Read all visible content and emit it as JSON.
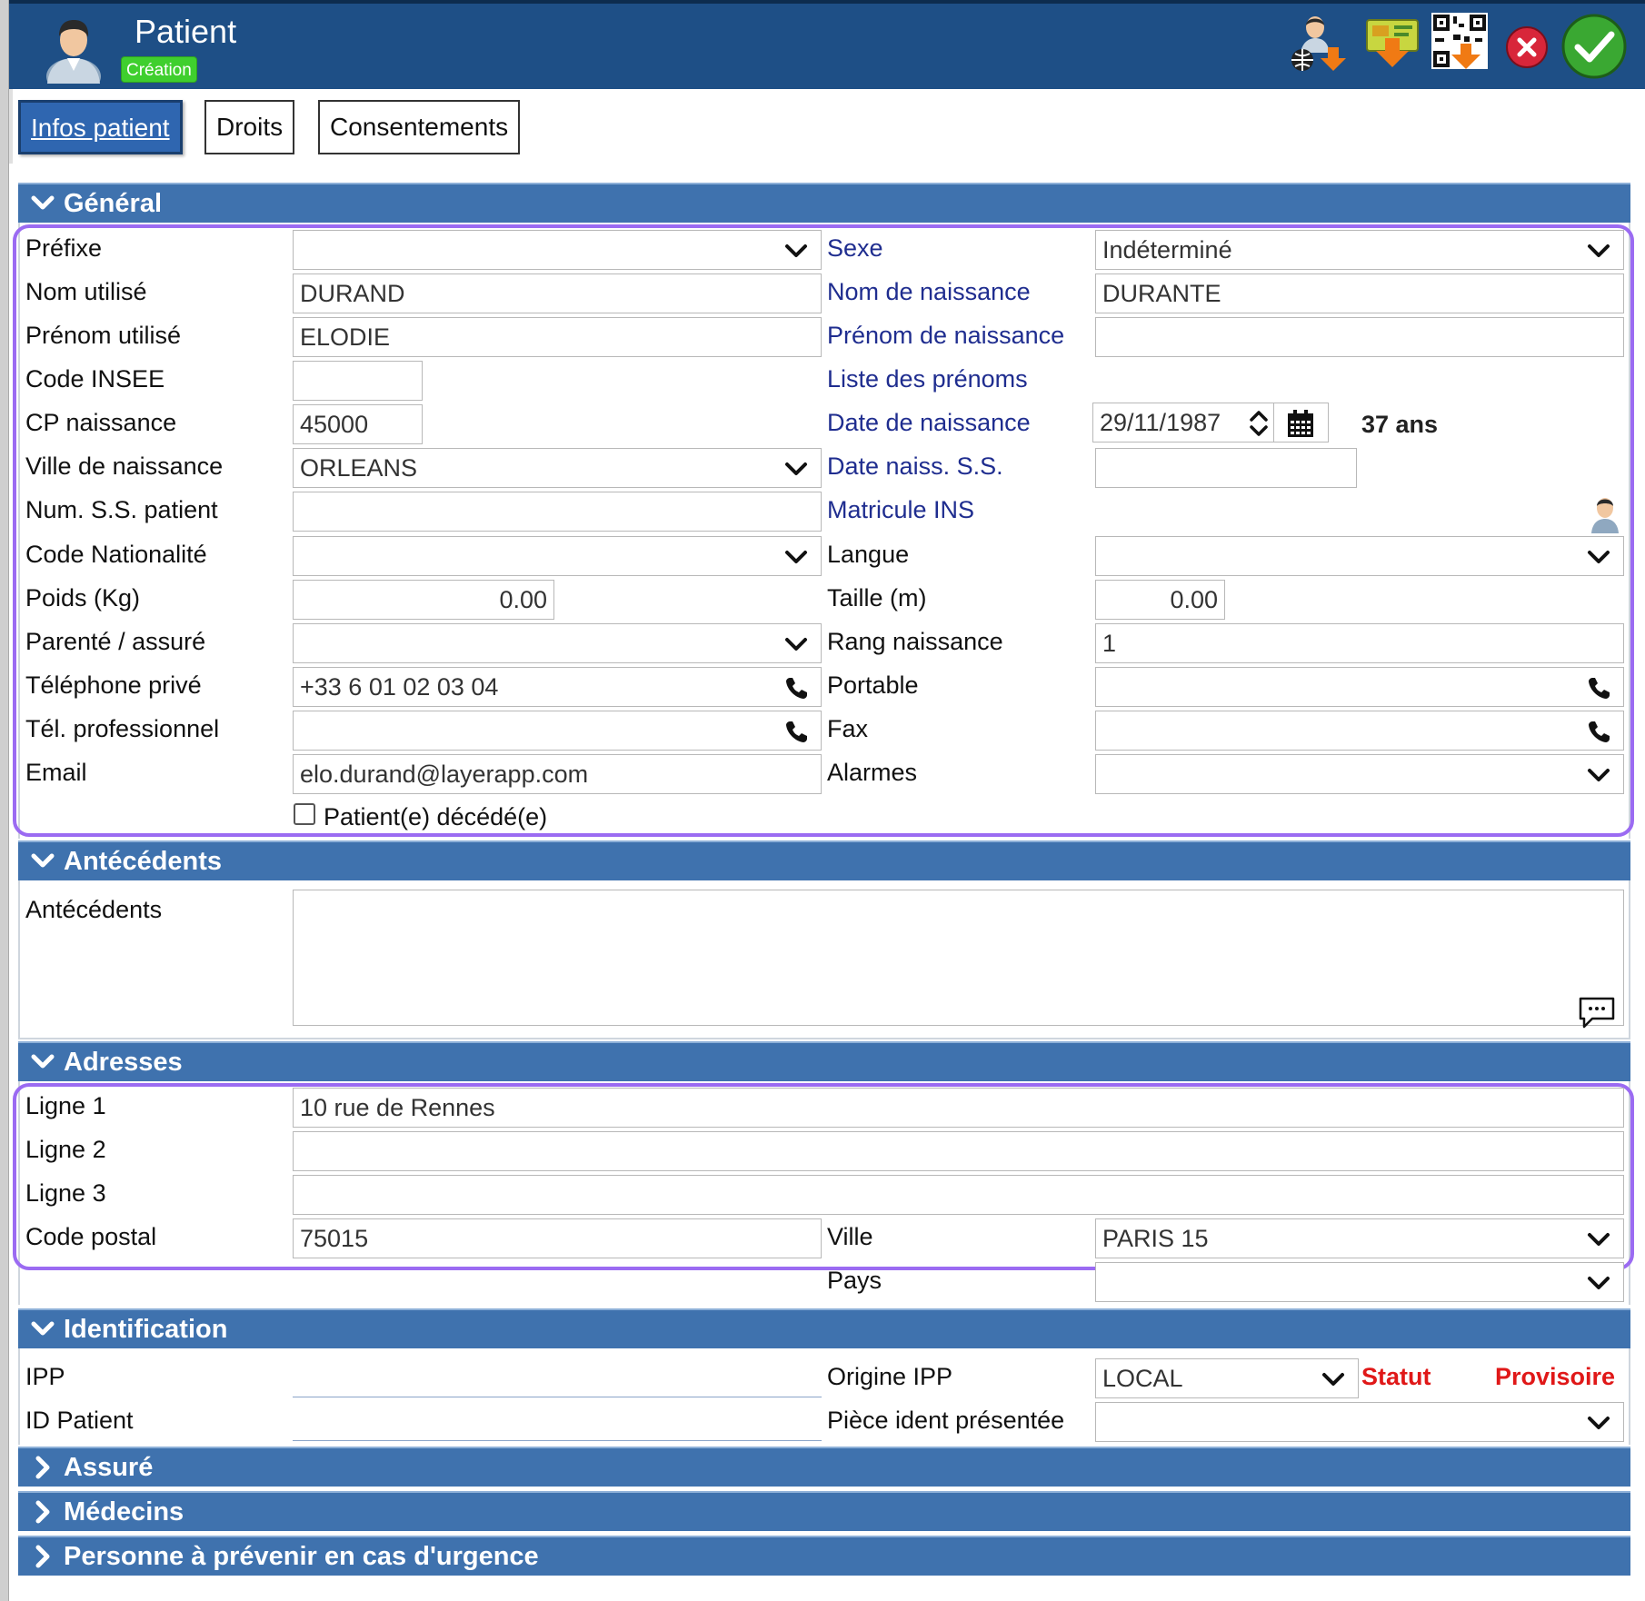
{
  "header": {
    "title": "Patient",
    "badge": "Création",
    "icons": [
      "user-globe-download-icon",
      "card-download-icon",
      "qrcode-download-icon",
      "cancel-icon",
      "confirm-icon"
    ]
  },
  "tabs": [
    {
      "label": "Infos patient",
      "active": true
    },
    {
      "label": "Droits",
      "active": false
    },
    {
      "label": "Consentements",
      "active": false
    }
  ],
  "sections": {
    "general": "Général",
    "antecedents": "Antécédents",
    "adresses": "Adresses",
    "identification": "Identification",
    "assure": "Assuré",
    "medecins": "Médecins",
    "urgence": "Personne à prévenir en cas d'urgence"
  },
  "general": {
    "prefixe": {
      "label": "Préfixe",
      "value": ""
    },
    "sexe": {
      "label": "Sexe",
      "value": "Indéterminé"
    },
    "nom_utilise": {
      "label": "Nom utilisé",
      "value": "DURAND"
    },
    "nom_naissance": {
      "label": "Nom de naissance",
      "value": "DURANTE"
    },
    "prenom_utilise": {
      "label": "Prénom utilisé",
      "value": "ELODIE"
    },
    "prenom_naissance": {
      "label": "Prénom de naissance",
      "value": ""
    },
    "code_insee": {
      "label": "Code INSEE",
      "value": ""
    },
    "liste_prenoms": {
      "label": "Liste des prénoms"
    },
    "cp_naissance": {
      "label": "CP naissance",
      "value": "45000"
    },
    "date_naissance": {
      "label": "Date de naissance",
      "value": "29/11/1987",
      "age": "37 ans"
    },
    "ville_naissance": {
      "label": "Ville de naissance",
      "value": "ORLEANS"
    },
    "date_naiss_ss": {
      "label": "Date naiss. S.S.",
      "value": ""
    },
    "num_ss": {
      "label": "Num. S.S. patient",
      "value": ""
    },
    "matricule_ins": {
      "label": "Matricule INS"
    },
    "code_nationalite": {
      "label": "Code Nationalité",
      "value": ""
    },
    "langue": {
      "label": "Langue",
      "value": ""
    },
    "poids": {
      "label": "Poids (Kg)",
      "value": "0.00"
    },
    "taille": {
      "label": "Taille (m)",
      "value": "0.00"
    },
    "parente": {
      "label": "Parenté / assuré",
      "value": ""
    },
    "rang_naissance": {
      "label": "Rang naissance",
      "value": "1"
    },
    "tel_prive": {
      "label": "Téléphone privé",
      "value": "+33 6 01 02 03 04"
    },
    "portable": {
      "label": "Portable",
      "value": ""
    },
    "tel_pro": {
      "label": "Tél. professionnel",
      "value": ""
    },
    "fax": {
      "label": "Fax",
      "value": ""
    },
    "email": {
      "label": "Email",
      "value": "elo.durand@layerapp.com"
    },
    "alarmes": {
      "label": "Alarmes",
      "value": ""
    },
    "decede": {
      "label": "Patient(e) décédé(e)",
      "checked": false
    }
  },
  "antecedents": {
    "label": "Antécédents",
    "value": ""
  },
  "adresses": {
    "ligne1": {
      "label": "Ligne 1",
      "value": "10 rue de Rennes"
    },
    "ligne2": {
      "label": "Ligne 2",
      "value": ""
    },
    "ligne3": {
      "label": "Ligne 3",
      "value": ""
    },
    "code_postal": {
      "label": "Code postal",
      "value": "75015"
    },
    "ville": {
      "label": "Ville",
      "value": "PARIS 15"
    },
    "pays": {
      "label": "Pays",
      "value": ""
    }
  },
  "identification": {
    "ipp": {
      "label": "IPP",
      "value": ""
    },
    "origine_ipp": {
      "label": "Origine IPP",
      "value": "LOCAL"
    },
    "statut": {
      "label": "Statut",
      "value": "Provisoire"
    },
    "id_patient": {
      "label": "ID Patient",
      "value": ""
    },
    "piece_ident": {
      "label": "Pièce ident présentée",
      "value": ""
    }
  },
  "colors": {
    "header": "#1e4f86",
    "section": "#3f72ae",
    "highlight": "#9b6bf2",
    "badge": "#3fcf2e",
    "required_label": "#1f2d8f",
    "status": "#e01818"
  }
}
